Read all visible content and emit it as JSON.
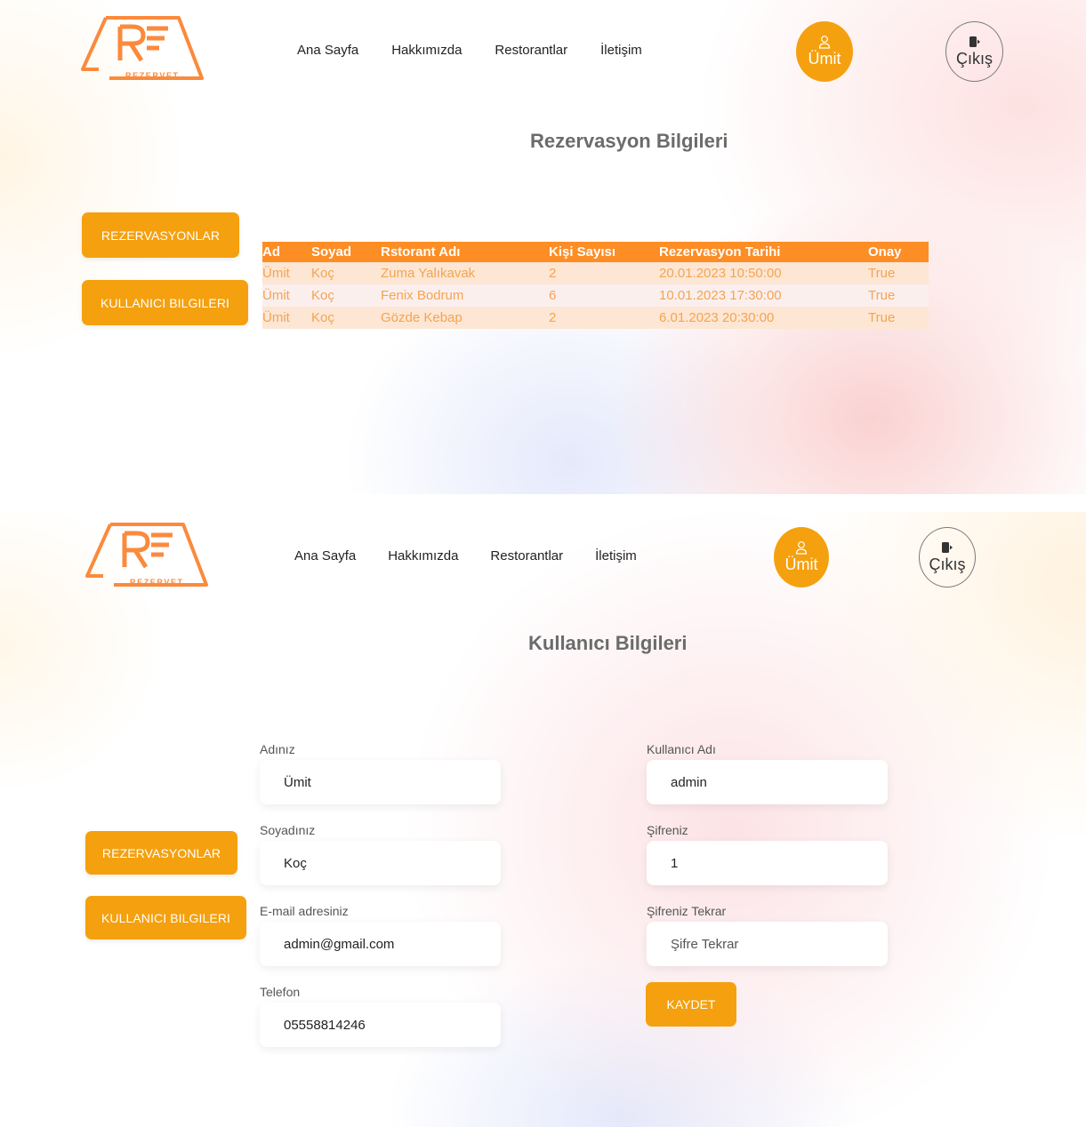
{
  "brand": {
    "logo_text": "REZERVET",
    "accent": "#f5a00e",
    "logo_color": "#fb8a3c"
  },
  "nav": {
    "items": [
      "Ana Sayfa",
      "Hakkımızda",
      "Restorantlar",
      "İletişim"
    ]
  },
  "user": {
    "name": "Ümit",
    "icon": "user-icon"
  },
  "logout": {
    "label": "Çıkış",
    "icon": "logout-icon"
  },
  "reservations_page": {
    "title": "Rezervasyon Bilgileri",
    "sidebar": {
      "reservations": "REZERVASYONLAR",
      "user_info": "KULLANICI BILGILERI"
    },
    "table": {
      "headers": [
        "Ad",
        "Soyad",
        "Rstorant Adı",
        "Kişi Sayısı",
        "Rezervasyon Tarihi",
        "Onay"
      ],
      "rows": [
        [
          "Ümit",
          "Koç",
          "Zuma Yalıkavak",
          "2",
          "20.01.2023 10:50:00",
          "True"
        ],
        [
          "Ümit",
          "Koç",
          "Fenix Bodrum",
          "6",
          "10.01.2023 17:30:00",
          "True"
        ],
        [
          "Ümit",
          "Koç",
          "Gözde Kebap",
          "2",
          "6.01.2023 20:30:00",
          "True"
        ]
      ]
    }
  },
  "user_page": {
    "title": "Kullanıcı Bilgileri",
    "sidebar": {
      "reservations": "REZERVASYONLAR",
      "user_info": "KULLANICI BILGILERI"
    },
    "form": {
      "first_name": {
        "label": "Adınız",
        "value": "Ümit"
      },
      "last_name": {
        "label": "Soyadınız",
        "value": "Koç"
      },
      "email": {
        "label": "E-mail adresiniz",
        "value": "admin@gmail.com"
      },
      "phone": {
        "label": "Telefon",
        "value": "05558814246"
      },
      "username": {
        "label": "Kullanıcı Adı",
        "value": "admin"
      },
      "password": {
        "label": "Şifreniz",
        "value": "1"
      },
      "password_repeat": {
        "label": "Şifreniz Tekrar",
        "value": "",
        "placeholder": "Şifre Tekrar"
      },
      "save_label": "KAYDET"
    }
  }
}
